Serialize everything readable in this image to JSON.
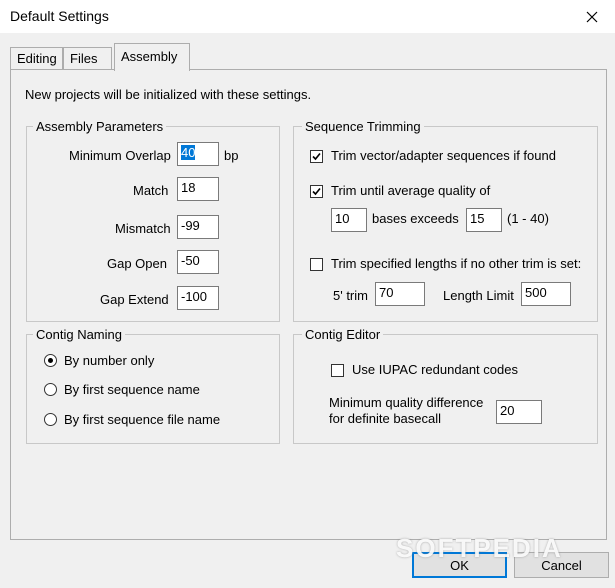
{
  "window": {
    "title": "Default Settings"
  },
  "tabs": [
    {
      "label": "Editing"
    },
    {
      "label": "Files"
    },
    {
      "label": "Assembly"
    }
  ],
  "intro": "New projects will be initialized with these settings.",
  "assembly_parameters": {
    "title": "Assembly Parameters",
    "min_overlap": {
      "label": "Minimum Overlap",
      "value": "40",
      "unit": "bp"
    },
    "match": {
      "label": "Match",
      "value": "18"
    },
    "mismatch": {
      "label": "Mismatch",
      "value": "-99"
    },
    "gap_open": {
      "label": "Gap Open",
      "value": "-50"
    },
    "gap_extend": {
      "label": "Gap Extend",
      "value": "-100"
    }
  },
  "sequence_trimming": {
    "title": "Sequence Trimming",
    "trim_vector": {
      "label": "Trim vector/adapter sequences if found",
      "checked": true
    },
    "trim_quality": {
      "label": "Trim until average quality of",
      "checked": true
    },
    "bases_value": "10",
    "bases_exceeds_label": "bases exceeds",
    "quality_value": "15",
    "quality_range": "(1 - 40)",
    "trim_lengths": {
      "label": "Trim specified lengths if no other trim is set:",
      "checked": false
    },
    "five_trim_label": "5' trim",
    "five_trim_value": "70",
    "length_limit_label": "Length Limit",
    "length_limit_value": "500"
  },
  "contig_naming": {
    "title": "Contig Naming",
    "options": [
      {
        "label": "By number only",
        "selected": true
      },
      {
        "label": "By first sequence name",
        "selected": false
      },
      {
        "label": "By first sequence file name",
        "selected": false
      }
    ]
  },
  "contig_editor": {
    "title": "Contig Editor",
    "iupac": {
      "label": "Use IUPAC redundant codes",
      "checked": false
    },
    "min_quality_label_1": "Minimum quality difference",
    "min_quality_label_2": "for definite basecall",
    "min_quality_value": "20"
  },
  "buttons": {
    "ok": "OK",
    "cancel": "Cancel"
  },
  "watermark": "SOFTPEDIA",
  "colors": {
    "accent": "#0078d7",
    "background": "#f0f0f0",
    "border": "#adadad"
  },
  "icons": {
    "close": "close-icon",
    "check": "check-icon"
  }
}
